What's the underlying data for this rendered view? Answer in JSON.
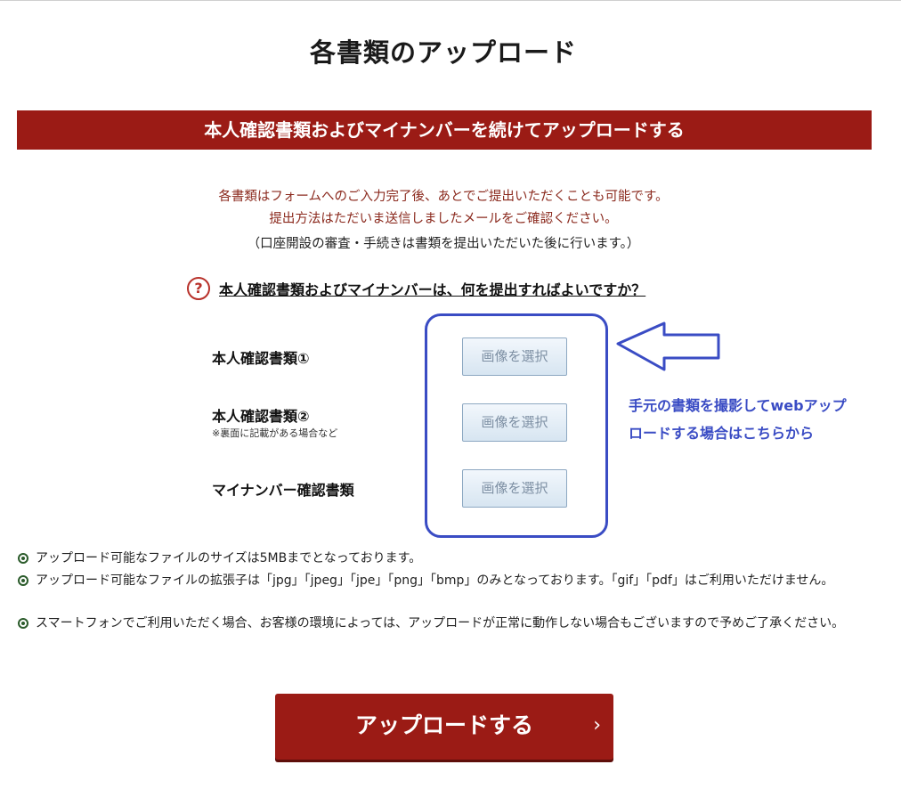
{
  "page_title": "各書類のアップロード",
  "section_banner": "本人確認書類およびマイナンバーを続けてアップロードする",
  "notices": {
    "line1": "各書類はフォームへのご入力完了後、あとでご提出いただくことも可能です。",
    "line2": "提出方法はただいま送信しましたメールをご確認ください。",
    "line3": "（口座開設の審査・手続きは書類を提出いただいた後に行います。）"
  },
  "help_link": {
    "icon": "?",
    "text": "本人確認書類およびマイナンバーは、何を提出すればよいですか？"
  },
  "documents": [
    {
      "label": "本人確認書類①",
      "note": "",
      "button": "画像を選択"
    },
    {
      "label": "本人確認書類②",
      "note": "※裏面に記載がある場合など",
      "button": "画像を選択"
    },
    {
      "label": "マイナンバー確認書類",
      "note": "",
      "button": "画像を選択"
    }
  ],
  "callout": {
    "line1": "手元の書類を撮影してwebアップ",
    "line2": "ロードする場合はこちらから"
  },
  "bullets": [
    "アップロード可能なファイルのサイズは5MBまでとなっております。",
    "アップロード可能なファイルの拡張子は「jpg」「jpeg」「jpe」「png」「bmp」のみとなっております。「gif」「pdf」はご利用いただけません。",
    "スマートフォンでご利用いただく場合、お客様の環境によっては、アップロードが正常に動作しない場合もございますので予めご了承ください。"
  ],
  "upload_button": {
    "label": "アップロードする",
    "chevron": "›"
  },
  "colors": {
    "brand_red": "#9b1b15",
    "annotation_blue": "#3a4cc4"
  }
}
